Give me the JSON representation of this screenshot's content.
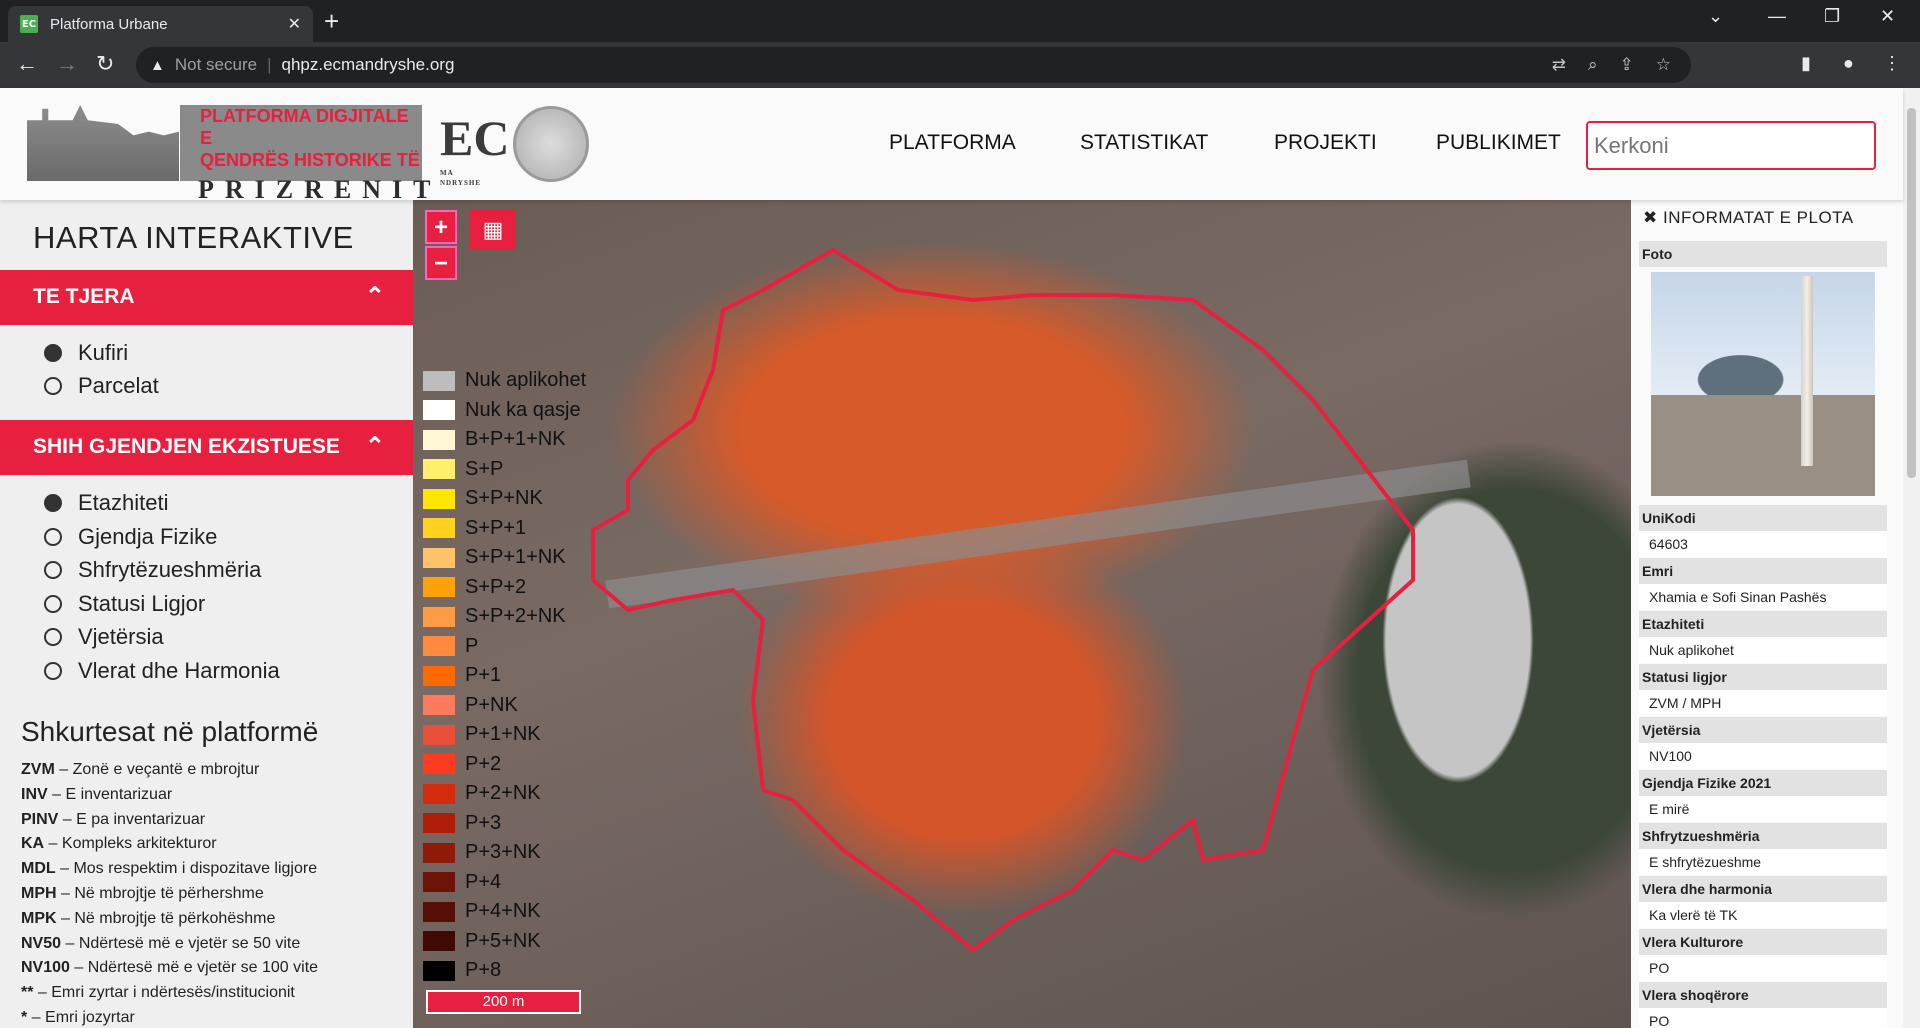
{
  "browser": {
    "tab_title": "Platforma Urbane",
    "favicon_text": "EC",
    "address_warning": "Not secure",
    "url": "qhpz.ecmandryshe.org"
  },
  "header": {
    "logo_line1": "PLATFORMA DIGJITALE E",
    "logo_line2": "QENDRËS HISTORIKE TË",
    "logo_line3": "PRIZRENIT",
    "ec_logo": "EC",
    "ec_logo_sub": "MA NDRYSHE",
    "nav": [
      "PLATFORMA",
      "STATISTIKAT",
      "PROJEKTI",
      "PUBLIKIMET"
    ],
    "search_placeholder": "Kerkoni"
  },
  "sidebar": {
    "title": "HARTA INTERAKTIVE",
    "section1": {
      "label": "TE TJERA",
      "items": [
        {
          "label": "Kufiri",
          "checked": true
        },
        {
          "label": "Parcelat",
          "checked": false
        }
      ]
    },
    "section2": {
      "label": "SHIH GJENDJEN EKZISTUESE",
      "items": [
        {
          "label": "Etazhiteti",
          "checked": true
        },
        {
          "label": "Gjendja Fizike",
          "checked": false
        },
        {
          "label": "Shfrytëzueshmëria",
          "checked": false
        },
        {
          "label": "Statusi Ligjor",
          "checked": false
        },
        {
          "label": "Vjetërsia",
          "checked": false
        },
        {
          "label": "Vlerat dhe Harmonia",
          "checked": false
        }
      ]
    },
    "shortcuts_title": "Shkurtesat në platformë",
    "shortcuts": [
      {
        "abbr": "ZVM",
        "text": " – Zonë e veçantë e mbrojtur"
      },
      {
        "abbr": "INV",
        "text": " – E inventarizuar"
      },
      {
        "abbr": "PINV",
        "text": " – E pa inventarizuar"
      },
      {
        "abbr": "KA",
        "text": " – Kompleks arkitekturor"
      },
      {
        "abbr": "MDL",
        "text": " – Mos respektim i dispozitave ligjore"
      },
      {
        "abbr": "MPH",
        "text": " – Në mbrojtje të përhershme"
      },
      {
        "abbr": "MPK",
        "text": " – Në mbrojtje të përkohëshme"
      },
      {
        "abbr": "NV50",
        "text": " – Ndërtesë më e vjetër se 50 vite"
      },
      {
        "abbr": "NV100",
        "text": " – Ndërtesë më e vjetër se 100 vite"
      },
      {
        "abbr": "**",
        "text": " – Emri zyrtar i ndërtesës/institucionit"
      },
      {
        "abbr": "*",
        "text": " – Emri jozyrtar"
      }
    ]
  },
  "map": {
    "zoom_in": "+",
    "zoom_out": "−",
    "scale": "200 m",
    "legend": [
      {
        "label": "Nuk aplikohet",
        "color": "#bdbdbd"
      },
      {
        "label": "Nuk ka qasje",
        "color": "#ffffff"
      },
      {
        "label": "B+P+1+NK",
        "color": "#fff6d5"
      },
      {
        "label": "S+P",
        "color": "#ffef6a"
      },
      {
        "label": "S+P+NK",
        "color": "#ffe600"
      },
      {
        "label": "S+P+1",
        "color": "#ffd21f"
      },
      {
        "label": "S+P+1+NK",
        "color": "#ffc266"
      },
      {
        "label": "S+P+2",
        "color": "#ffa20a"
      },
      {
        "label": "S+P+2+NK",
        "color": "#ff9a45"
      },
      {
        "label": "P",
        "color": "#ff8a3d"
      },
      {
        "label": "P+1",
        "color": "#ff6a00"
      },
      {
        "label": "P+NK",
        "color": "#ff7a5c"
      },
      {
        "label": "P+1+NK",
        "color": "#e8503a"
      },
      {
        "label": "P+2",
        "color": "#ff3b1f"
      },
      {
        "label": "P+2+NK",
        "color": "#d42a0e"
      },
      {
        "label": "P+3",
        "color": "#b01e0a"
      },
      {
        "label": "P+3+NK",
        "color": "#8e1a08"
      },
      {
        "label": "P+4",
        "color": "#6e1406"
      },
      {
        "label": "P+4+NK",
        "color": "#560f05"
      },
      {
        "label": "P+5+NK",
        "color": "#3e0a03"
      },
      {
        "label": "P+8",
        "color": "#000000"
      }
    ]
  },
  "info": {
    "close": "✖",
    "title": "INFORMATAT E PLOTA",
    "photo_label": "Foto",
    "fields": [
      {
        "label": "UniKodi",
        "value": "64603"
      },
      {
        "label": "Emri",
        "value": "Xhamia e Sofi Sinan Pashës"
      },
      {
        "label": "Etazhiteti",
        "value": "Nuk aplikohet"
      },
      {
        "label": "Statusi ligjor",
        "value": "ZVM / MPH"
      },
      {
        "label": "Vjetërsia",
        "value": "NV100"
      },
      {
        "label": "Gjendja Fizike 2021",
        "value": "E mirë"
      },
      {
        "label": "Shfrytzueshmëria",
        "value": "E shfrytëzueshme"
      },
      {
        "label": "Vlera dhe harmonia",
        "value": "Ka vlerë të TK"
      },
      {
        "label": "Vlera Kulturore",
        "value": "PO"
      },
      {
        "label": "Vlera shoqërore",
        "value": "PO"
      }
    ]
  }
}
